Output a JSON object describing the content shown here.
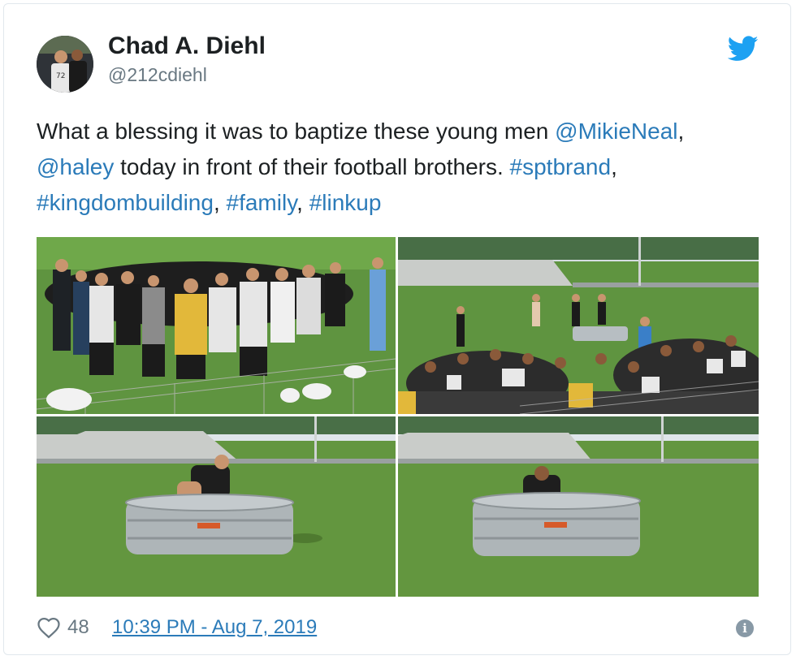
{
  "tweet": {
    "author_name": "Chad A. Diehl",
    "author_handle": "@212cdiehl",
    "text_parts": [
      {
        "type": "text",
        "value": "What a blessing it was to baptize these young men "
      },
      {
        "type": "link",
        "value": "@MikieNeal"
      },
      {
        "type": "text",
        "value": ", "
      },
      {
        "type": "link",
        "value": "@haley"
      },
      {
        "type": "text",
        "value": " today in front of their football brothers. "
      },
      {
        "type": "link",
        "value": "#sptbrand"
      },
      {
        "type": "text",
        "value": ", "
      },
      {
        "type": "link",
        "value": "#kingdombuilding"
      },
      {
        "type": "text",
        "value": ", "
      },
      {
        "type": "link",
        "value": "#family"
      },
      {
        "type": "text",
        "value": ", "
      },
      {
        "type": "link",
        "value": "#linkup"
      }
    ],
    "like_count": "48",
    "timestamp": "10:39 PM - Aug 7, 2019",
    "info_icon_glyph": "i"
  },
  "icons": {
    "brand": "twitter-bird-icon",
    "like": "heart-icon",
    "info": "info-icon"
  },
  "colors": {
    "link": "#2b7bb9",
    "twitter_blue": "#1da1f2",
    "muted": "#697882",
    "border": "#e1e8ed"
  }
}
